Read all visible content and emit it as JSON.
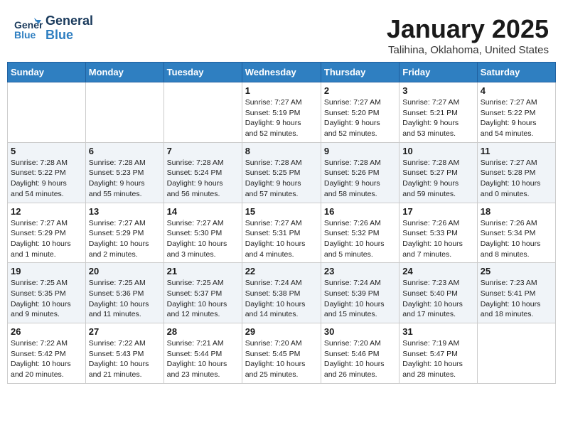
{
  "header": {
    "logo": {
      "line1": "General",
      "line2": "Blue"
    },
    "month": "January 2025",
    "location": "Talihina, Oklahoma, United States"
  },
  "weekdays": [
    "Sunday",
    "Monday",
    "Tuesday",
    "Wednesday",
    "Thursday",
    "Friday",
    "Saturday"
  ],
  "weeks": [
    [
      {
        "day": "",
        "info": ""
      },
      {
        "day": "",
        "info": ""
      },
      {
        "day": "",
        "info": ""
      },
      {
        "day": "1",
        "info": "Sunrise: 7:27 AM\nSunset: 5:19 PM\nDaylight: 9 hours\nand 52 minutes."
      },
      {
        "day": "2",
        "info": "Sunrise: 7:27 AM\nSunset: 5:20 PM\nDaylight: 9 hours\nand 52 minutes."
      },
      {
        "day": "3",
        "info": "Sunrise: 7:27 AM\nSunset: 5:21 PM\nDaylight: 9 hours\nand 53 minutes."
      },
      {
        "day": "4",
        "info": "Sunrise: 7:27 AM\nSunset: 5:22 PM\nDaylight: 9 hours\nand 54 minutes."
      }
    ],
    [
      {
        "day": "5",
        "info": "Sunrise: 7:28 AM\nSunset: 5:22 PM\nDaylight: 9 hours\nand 54 minutes."
      },
      {
        "day": "6",
        "info": "Sunrise: 7:28 AM\nSunset: 5:23 PM\nDaylight: 9 hours\nand 55 minutes."
      },
      {
        "day": "7",
        "info": "Sunrise: 7:28 AM\nSunset: 5:24 PM\nDaylight: 9 hours\nand 56 minutes."
      },
      {
        "day": "8",
        "info": "Sunrise: 7:28 AM\nSunset: 5:25 PM\nDaylight: 9 hours\nand 57 minutes."
      },
      {
        "day": "9",
        "info": "Sunrise: 7:28 AM\nSunset: 5:26 PM\nDaylight: 9 hours\nand 58 minutes."
      },
      {
        "day": "10",
        "info": "Sunrise: 7:28 AM\nSunset: 5:27 PM\nDaylight: 9 hours\nand 59 minutes."
      },
      {
        "day": "11",
        "info": "Sunrise: 7:27 AM\nSunset: 5:28 PM\nDaylight: 10 hours\nand 0 minutes."
      }
    ],
    [
      {
        "day": "12",
        "info": "Sunrise: 7:27 AM\nSunset: 5:29 PM\nDaylight: 10 hours\nand 1 minute."
      },
      {
        "day": "13",
        "info": "Sunrise: 7:27 AM\nSunset: 5:29 PM\nDaylight: 10 hours\nand 2 minutes."
      },
      {
        "day": "14",
        "info": "Sunrise: 7:27 AM\nSunset: 5:30 PM\nDaylight: 10 hours\nand 3 minutes."
      },
      {
        "day": "15",
        "info": "Sunrise: 7:27 AM\nSunset: 5:31 PM\nDaylight: 10 hours\nand 4 minutes."
      },
      {
        "day": "16",
        "info": "Sunrise: 7:26 AM\nSunset: 5:32 PM\nDaylight: 10 hours\nand 5 minutes."
      },
      {
        "day": "17",
        "info": "Sunrise: 7:26 AM\nSunset: 5:33 PM\nDaylight: 10 hours\nand 7 minutes."
      },
      {
        "day": "18",
        "info": "Sunrise: 7:26 AM\nSunset: 5:34 PM\nDaylight: 10 hours\nand 8 minutes."
      }
    ],
    [
      {
        "day": "19",
        "info": "Sunrise: 7:25 AM\nSunset: 5:35 PM\nDaylight: 10 hours\nand 9 minutes."
      },
      {
        "day": "20",
        "info": "Sunrise: 7:25 AM\nSunset: 5:36 PM\nDaylight: 10 hours\nand 11 minutes."
      },
      {
        "day": "21",
        "info": "Sunrise: 7:25 AM\nSunset: 5:37 PM\nDaylight: 10 hours\nand 12 minutes."
      },
      {
        "day": "22",
        "info": "Sunrise: 7:24 AM\nSunset: 5:38 PM\nDaylight: 10 hours\nand 14 minutes."
      },
      {
        "day": "23",
        "info": "Sunrise: 7:24 AM\nSunset: 5:39 PM\nDaylight: 10 hours\nand 15 minutes."
      },
      {
        "day": "24",
        "info": "Sunrise: 7:23 AM\nSunset: 5:40 PM\nDaylight: 10 hours\nand 17 minutes."
      },
      {
        "day": "25",
        "info": "Sunrise: 7:23 AM\nSunset: 5:41 PM\nDaylight: 10 hours\nand 18 minutes."
      }
    ],
    [
      {
        "day": "26",
        "info": "Sunrise: 7:22 AM\nSunset: 5:42 PM\nDaylight: 10 hours\nand 20 minutes."
      },
      {
        "day": "27",
        "info": "Sunrise: 7:22 AM\nSunset: 5:43 PM\nDaylight: 10 hours\nand 21 minutes."
      },
      {
        "day": "28",
        "info": "Sunrise: 7:21 AM\nSunset: 5:44 PM\nDaylight: 10 hours\nand 23 minutes."
      },
      {
        "day": "29",
        "info": "Sunrise: 7:20 AM\nSunset: 5:45 PM\nDaylight: 10 hours\nand 25 minutes."
      },
      {
        "day": "30",
        "info": "Sunrise: 7:20 AM\nSunset: 5:46 PM\nDaylight: 10 hours\nand 26 minutes."
      },
      {
        "day": "31",
        "info": "Sunrise: 7:19 AM\nSunset: 5:47 PM\nDaylight: 10 hours\nand 28 minutes."
      },
      {
        "day": "",
        "info": ""
      }
    ]
  ]
}
